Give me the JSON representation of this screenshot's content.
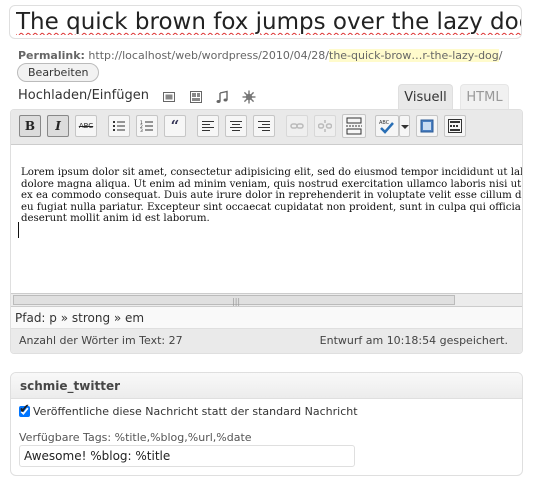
{
  "post": {
    "title": "The quick brown fox jumps over the lazy dog",
    "permalink_label": "Permalink:",
    "permalink_base": "http://localhost/web/wordpress/2010/04/28/",
    "permalink_slug": "the-quick-brow…r-the-lazy-dog",
    "permalink_trailing": "/",
    "edit_button": "Bearbeiten"
  },
  "media": {
    "label": "Hochladen/Einfügen",
    "icons": [
      "image-icon",
      "gallery-icon",
      "music-icon",
      "media-icon"
    ]
  },
  "tabs": {
    "visual": "Visuell",
    "html": "HTML"
  },
  "toolbar": {
    "bold": "B",
    "italic": "I",
    "strikethrough": "ABC",
    "buttons": [
      "bold-icon",
      "italic-icon",
      "strikethrough-icon",
      "bulleted-list-icon",
      "numbered-list-icon",
      "blockquote-icon",
      "align-left-icon",
      "align-center-icon",
      "align-right-icon",
      "link-icon",
      "unlink-icon",
      "more-tag-icon",
      "spellcheck-icon",
      "fullscreen-icon",
      "kitchen-sink-icon"
    ]
  },
  "editor": {
    "content": "Lorem ipsum dolor sit amet, consectetur adipisicing elit, sed do eiusmod tempor incididunt ut labore et dolore magna aliqua. Ut enim ad minim veniam, quis nostrud exercitation ullamco laboris nisi ut aliquip ex ea commodo consequat. Duis aute irure dolor in reprehenderit in voluptate velit esse cillum dolore eu fugiat nulla pariatur. Excepteur sint occaecat cupidatat non proident, sunt in culpa qui officia deserunt mollit anim id est laborum.",
    "path": "Pfad: p » strong » em",
    "word_count": "Anzahl der Wörter im Text: 27",
    "draft_saved": "Entwurf am 10:18:54 gespeichert."
  },
  "twitter_box": {
    "title": "schmie_twitter",
    "checkbox_label": "Veröffentliche diese Nachricht statt der standard Nachricht",
    "checkbox_checked": true,
    "tags_label": "Verfügbare Tags: %title,%blog,%url,%date",
    "message_value": "Awesome! %blog: %title"
  },
  "colors": {
    "slug_highlight": "#fffbcc",
    "toolbar_bg": "#e9e9e9",
    "border": "#dfdfdf"
  }
}
